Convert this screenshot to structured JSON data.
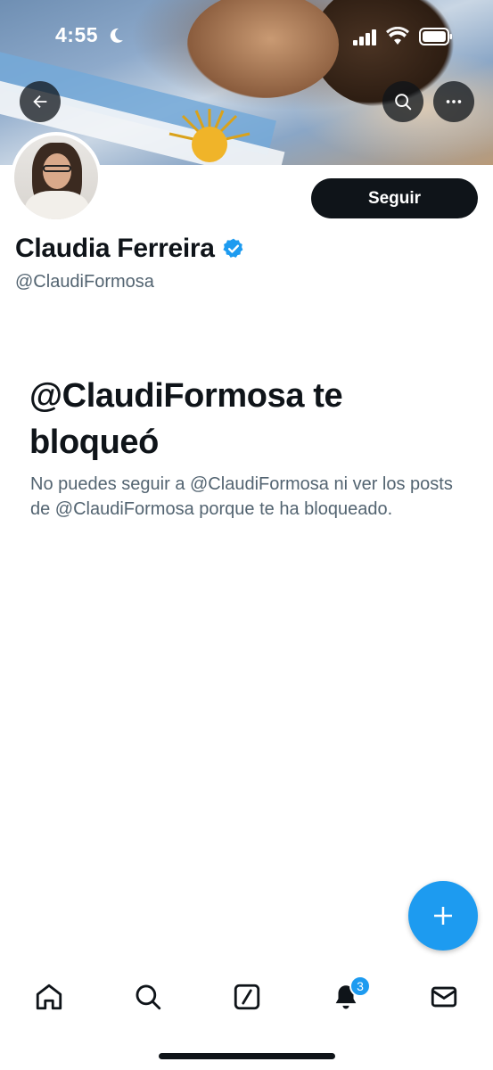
{
  "status_bar": {
    "time": "4:55",
    "icons": [
      "moon-icon",
      "signal-icon",
      "wifi-icon",
      "battery-icon"
    ]
  },
  "header": {
    "back_icon": "arrow-left-icon",
    "search_icon": "search-icon",
    "more_icon": "more-icon"
  },
  "profile": {
    "name": "Claudia Ferreira",
    "handle": "@ClaudiFormosa",
    "verified": true,
    "follow_label": "Seguir"
  },
  "blocked": {
    "title": "@ClaudiFormosa te bloqueó",
    "description": "No puedes seguir a @ClaudiFormosa ni ver los posts de @ClaudiFormosa porque te ha bloqueado."
  },
  "fab": {
    "icon": "plus-icon"
  },
  "tabbar": {
    "items": [
      "home-icon",
      "search-icon",
      "grok-icon",
      "bell-icon",
      "mail-icon"
    ],
    "notifications_badge": "3"
  },
  "colors": {
    "accent": "#1d9bf0",
    "text_primary": "#0f1419",
    "text_secondary": "#536471"
  }
}
